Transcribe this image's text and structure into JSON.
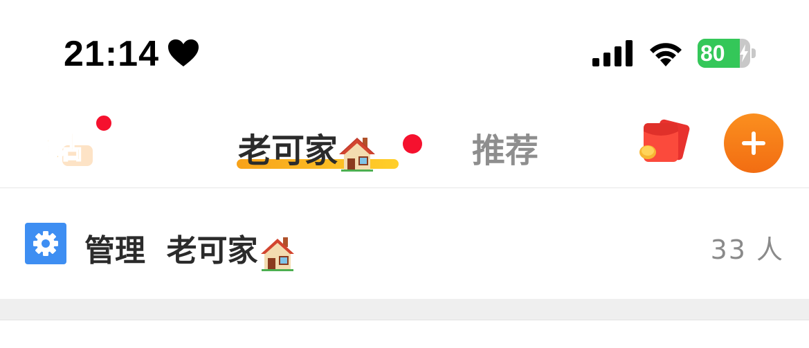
{
  "status_bar": {
    "time": "21:14",
    "battery_level": "80",
    "battery_fraction": 0.8,
    "icons": [
      "heart-icon",
      "signal-icon",
      "wifi-icon",
      "battery-icon",
      "charging-bolt-icon"
    ]
  },
  "nav": {
    "logo_text": "超话",
    "tabs": [
      {
        "label": "老可家",
        "active": true
      },
      {
        "label": "推荐",
        "active": false
      }
    ],
    "icons": [
      "house-icon",
      "red-packet-icon",
      "plus-icon"
    ]
  },
  "manage": {
    "prefix": "管理",
    "name": "老可家",
    "count": "33 人",
    "icon": "settings-gear-icon"
  },
  "colors": {
    "accent_orange": "#f7a21a",
    "add_button": "#f26d12",
    "notification_dot": "#f5112e",
    "settings_tile": "#3e8ef2",
    "battery_green": "#34c759"
  }
}
